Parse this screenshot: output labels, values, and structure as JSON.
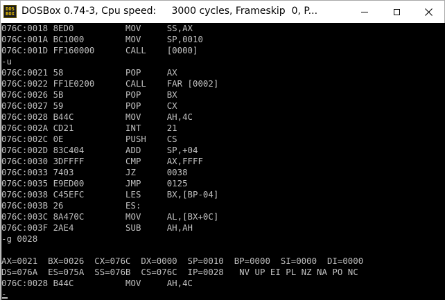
{
  "window": {
    "title": "DOSBox 0.74-3, Cpu speed:     3000 cycles, Frameskip  0, P...",
    "icon_lines": [
      "DOS",
      "BOX"
    ],
    "buttons": {
      "minimize": "minimize-icon",
      "maximize": "maximize-icon",
      "close": "close-icon"
    }
  },
  "console": {
    "lines": [
      "076C:0018 8ED0          MOV     SS,AX",
      "076C:001A BC1000        MOV     SP,0010",
      "076C:001D FF160000      CALL    [0000]",
      "-u",
      "076C:0021 58            POP     AX",
      "076C:0022 FF1E0200      CALL    FAR [0002]",
      "076C:0026 5B            POP     BX",
      "076C:0027 59            POP     CX",
      "076C:0028 B44C          MOV     AH,4C",
      "076C:002A CD21          INT     21",
      "076C:002C 0E            PUSH    CS",
      "076C:002D 83C404        ADD     SP,+04",
      "076C:0030 3DFFFF        CMP     AX,FFFF",
      "076C:0033 7403          JZ      0038",
      "076C:0035 E9ED00        JMP     0125",
      "076C:0038 C45EFC        LES     BX,[BP-04]",
      "076C:003B 26            ES:",
      "076C:003C 8A470C        MOV     AL,[BX+0C]",
      "076C:003F 2AE4          SUB     AH,AH",
      "-g 0028",
      "",
      "AX=0021  BX=0026  CX=076C  DX=0000  SP=0010  BP=0000  SI=0000  DI=0000",
      "DS=076A  ES=075A  SS=076B  CS=076C  IP=0028   NV UP EI PL NZ NA PO NC",
      "076C:0028 B44C          MOV     AH,4C",
      "-"
    ]
  }
}
